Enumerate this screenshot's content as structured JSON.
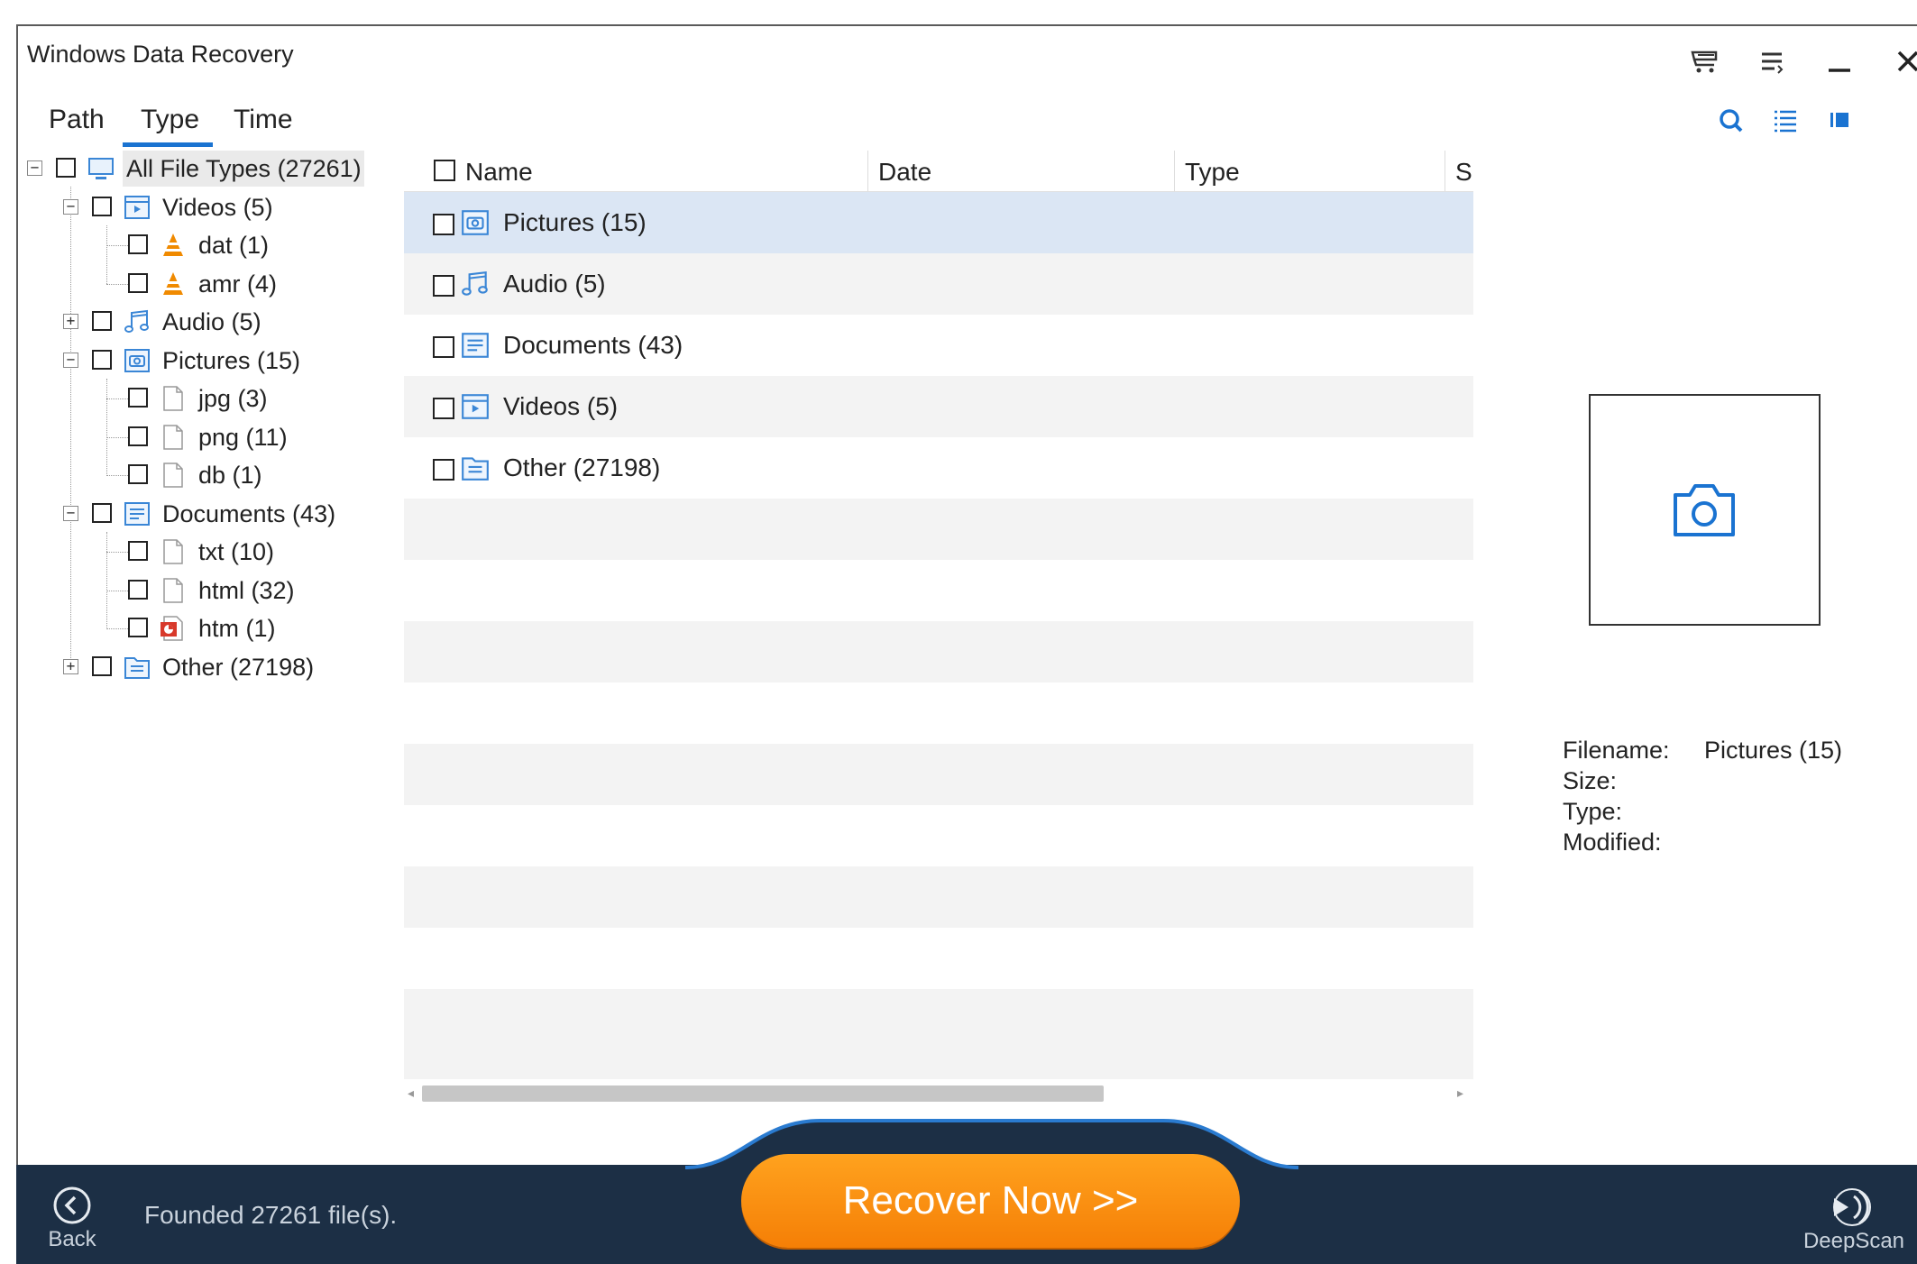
{
  "window": {
    "title": "Windows Data Recovery"
  },
  "titlebar_icons": [
    "cart-icon",
    "menu-icon",
    "minimize-icon",
    "close-icon"
  ],
  "view_icons": [
    "search-icon",
    "list-view-icon",
    "preview-view-icon"
  ],
  "tabs": [
    {
      "label": "Path"
    },
    {
      "label": "Type",
      "active": true
    },
    {
      "label": "Time"
    }
  ],
  "tree": {
    "root": "All File Types (27261)",
    "videos": "Videos (5)",
    "dat": "dat (1)",
    "amr": "amr (4)",
    "audio": "Audio (5)",
    "pictures": "Pictures (15)",
    "jpg": "jpg (3)",
    "png": "png (11)",
    "db": "db (1)",
    "documents": "Documents (43)",
    "txt": "txt (10)",
    "html": "html (32)",
    "htm": "htm (1)",
    "other": "Other (27198)"
  },
  "list": {
    "columns": [
      "Name",
      "Date",
      "Type",
      "S"
    ],
    "rows": [
      {
        "name": "Pictures (15)",
        "icon": "pictures-icon",
        "selected": true
      },
      {
        "name": "Audio (5)",
        "icon": "audio-icon"
      },
      {
        "name": "Documents (43)",
        "icon": "documents-icon"
      },
      {
        "name": "Videos (5)",
        "icon": "videos-icon"
      },
      {
        "name": "Other (27198)",
        "icon": "other-icon"
      }
    ]
  },
  "preview": {
    "filename_label": "Filename:",
    "filename_value": "Pictures (15)",
    "size_label": "Size:",
    "type_label": "Type:",
    "modified_label": "Modified:"
  },
  "bottom": {
    "back_label": "Back",
    "status": "Founded 27261 file(s).",
    "recover_label": "Recover Now  >>",
    "deepscan_label": "DeepScan"
  },
  "colors": {
    "accent": "#1a73d1",
    "bottom_bar": "#1c2f45",
    "recover_button": "#f98c0c",
    "selected_row": "#dbe6f4"
  }
}
